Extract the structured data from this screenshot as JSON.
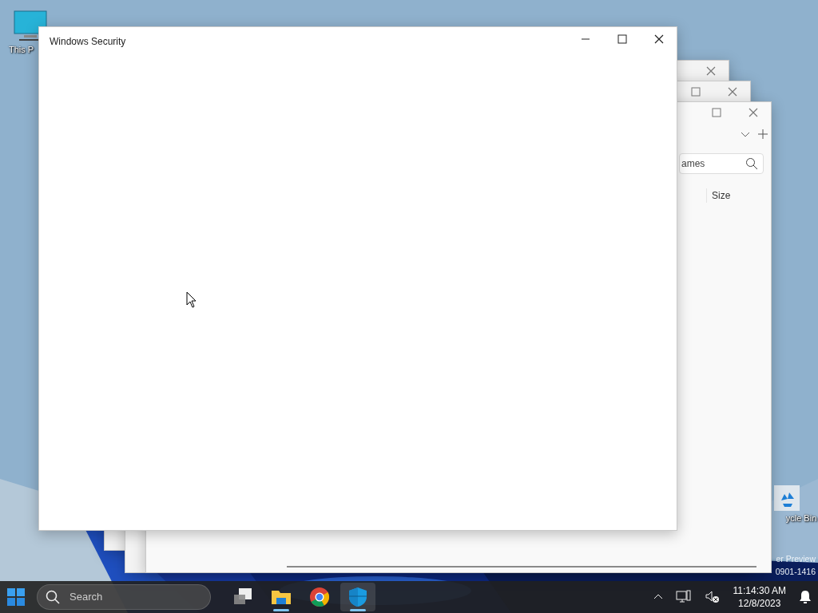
{
  "desktop_icons": [
    {
      "kind": "computer",
      "label": "This P"
    },
    {
      "kind": "recycle",
      "label": "ycle Bin"
    }
  ],
  "watermark_lines": [
    "er Preview",
    "0901-1416"
  ],
  "background_windows": [
    {
      "search_text": "ames",
      "column_header": "Size"
    }
  ],
  "active_window": {
    "title": "Windows Security"
  },
  "taskbar": {
    "search": {
      "placeholder": "Search"
    },
    "apps": [
      {
        "kind": "taskview",
        "running": false,
        "selected": false
      },
      {
        "kind": "folder",
        "running": true,
        "selected": false
      },
      {
        "kind": "browser",
        "running": false,
        "selected": false
      },
      {
        "kind": "shield",
        "running": true,
        "selected": true
      }
    ]
  },
  "tray": {
    "time": "11:14:30 AM",
    "date": "12/8/2023"
  }
}
